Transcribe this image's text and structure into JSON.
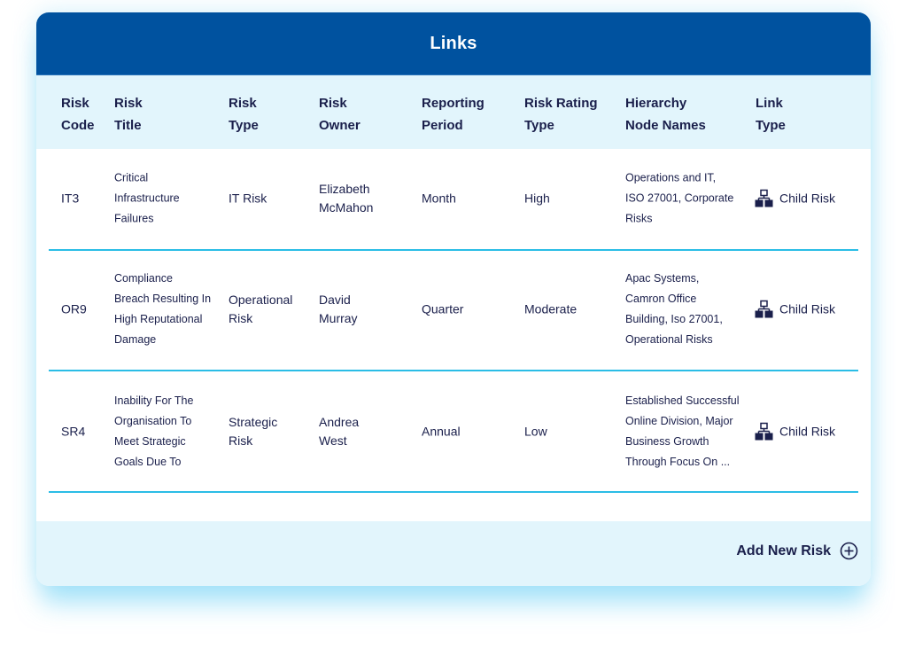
{
  "panel": {
    "title": "Links"
  },
  "table": {
    "columns": [
      {
        "key": "code",
        "label": "Risk\nCode"
      },
      {
        "key": "title",
        "label": "Risk\nTitle"
      },
      {
        "key": "type",
        "label": "Risk\nType"
      },
      {
        "key": "owner",
        "label": "Risk\nOwner"
      },
      {
        "key": "period",
        "label": "Reporting\nPeriod"
      },
      {
        "key": "rating",
        "label": "Risk Rating\nType"
      },
      {
        "key": "hierarchy",
        "label": "Hierarchy\nNode Names"
      },
      {
        "key": "link",
        "label": "Link\nType"
      }
    ],
    "rows": [
      {
        "code": "IT3",
        "title": "Critical\nInfrastructure\nFailures",
        "type": "IT Risk",
        "owner": "Elizabeth\nMcMahon",
        "period": "Month",
        "rating": "High",
        "hierarchy": "Operations and IT,\nISO 27001, Corporate\nRisks",
        "link": "Child Risk",
        "link_icon": "hierarchy-icon"
      },
      {
        "code": "OR9",
        "title": "Compliance\nBreach Resulting In\nHigh Reputational\nDamage",
        "type": "Operational\nRisk",
        "owner": "David\nMurray",
        "period": "Quarter",
        "rating": "Moderate",
        "hierarchy": "Apac Systems,\nCamron Office\nBuilding, Iso 27001,\nOperational Risks",
        "link": "Child Risk",
        "link_icon": "hierarchy-icon"
      },
      {
        "code": "SR4",
        "title": "Inability For The\nOrganisation To\nMeet Strategic\nGoals Due To",
        "type": "Strategic\nRisk",
        "owner": "Andrea\nWest",
        "period": "Annual",
        "rating": "Low",
        "hierarchy": "Established Successful\nOnline Division, Major\nBusiness Growth\nThrough Focus On ...",
        "link": "Child Risk",
        "link_icon": "hierarchy-icon"
      }
    ]
  },
  "footer": {
    "add_label": "Add New Risk",
    "add_icon": "plus-circle-icon"
  },
  "colors": {
    "header_bg": "#00529f",
    "band_bg": "#e2f5fc",
    "divider": "#2bbde6",
    "text": "#1a1f4b"
  }
}
